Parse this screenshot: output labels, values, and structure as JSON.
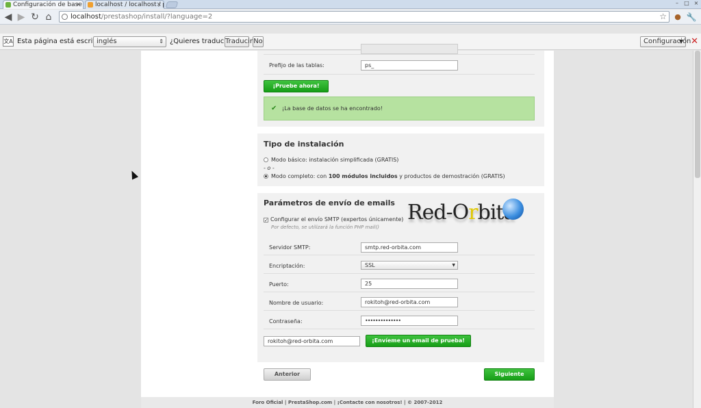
{
  "browser": {
    "tabs": [
      {
        "title": "Configuración de base",
        "close": "×"
      },
      {
        "title": "localhost / localhost / p",
        "close": "×"
      }
    ],
    "url_host": "localhost",
    "url_path": "/prestashop/install/?language=2"
  },
  "translate_bar": {
    "prefix": "Esta página está escrita en",
    "language": "inglés",
    "question": "¿Quieres traducirla?",
    "translate_button": "Traducir",
    "no_button": "No",
    "config_button": "Configuración"
  },
  "database": {
    "prefix_label": "Prefijo de las tablas:",
    "prefix_value": "ps_",
    "test_button": "¡Pruebe ahora!",
    "success_message": "¡La base de datos se ha encontrado!"
  },
  "install_type": {
    "title": "Tipo de instalación",
    "basic_option": "Modo básico: instalación simplificada (GRATIS)",
    "separator": "- o -",
    "full_option_before": "Modo completo: con",
    "full_option_bold": "100 módulos incluidos",
    "full_option_after": "y productos de demostración (GRATIS)"
  },
  "email": {
    "title": "Parámetros de envío de emails",
    "smtp_checkbox_label": "Configurar el envío SMTP (expertos únicamente)",
    "smtp_hint": "Por defecto, se utilizará la función PHP mail()",
    "logo_text_1": "Red-O",
    "logo_text_2": "r",
    "logo_text_3": "bita",
    "server_label": "Servidor SMTP:",
    "server_value": "smtp.red-orbita.com",
    "encryption_label": "Encriptación:",
    "encryption_value": "SSL",
    "port_label": "Puerto:",
    "port_value": "25",
    "user_label": "Nombre de usuario:",
    "user_value": "rokitoh@red-orbita.com",
    "password_label": "Contraseña:",
    "password_value": "••••••••••••••",
    "test_email_value": "rokitoh@red-orbita.com",
    "test_email_button": "¡Envíeme un email de prueba!"
  },
  "nav": {
    "previous": "Anterior",
    "next": "Siguiente"
  },
  "footer": {
    "text": "Foro Oficial | PrestaShop.com | ¡Contacte con nosotros! | © 2007-2012"
  }
}
